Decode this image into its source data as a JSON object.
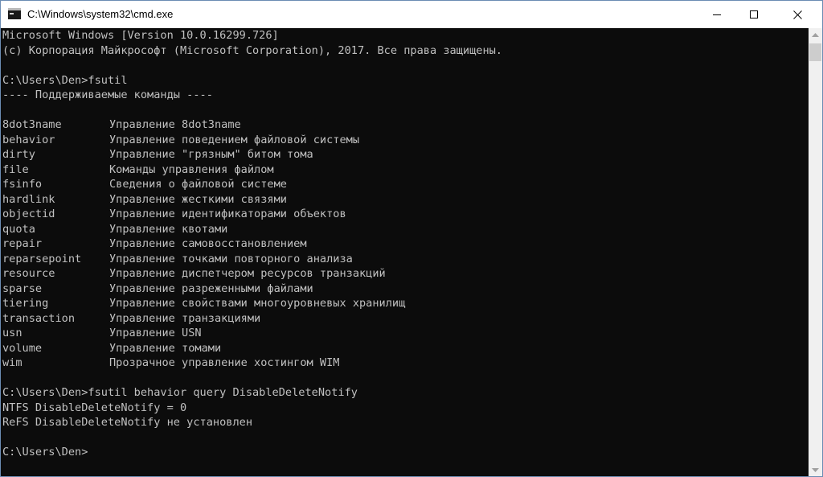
{
  "window": {
    "title": "C:\\Windows\\system32\\cmd.exe"
  },
  "console": {
    "header": [
      "Microsoft Windows [Version 10.0.16299.726]",
      "(c) Корпорация Майкрософт (Microsoft Corporation), 2017. Все права защищены."
    ],
    "prompt1": "C:\\Users\\Den>fsutil",
    "supported_header": "---- Поддерживаемые команды ----",
    "commands": [
      {
        "name": "8dot3name",
        "description": "Управление 8dot3name"
      },
      {
        "name": "behavior",
        "description": "Управление поведением файловой системы"
      },
      {
        "name": "dirty",
        "description": "Управление \"грязным\" битом тома"
      },
      {
        "name": "file",
        "description": "Команды управления файлом"
      },
      {
        "name": "fsinfo",
        "description": "Сведения о файловой системе"
      },
      {
        "name": "hardlink",
        "description": "Управление жесткими связями"
      },
      {
        "name": "objectid",
        "description": "Управление идентификаторами объектов"
      },
      {
        "name": "quota",
        "description": "Управление квотами"
      },
      {
        "name": "repair",
        "description": "Управление самовосстановлением"
      },
      {
        "name": "reparsepoint",
        "description": "Управление точками повторного анализа"
      },
      {
        "name": "resource",
        "description": "Управление диспетчером ресурсов транзакций"
      },
      {
        "name": "sparse",
        "description": "Управление разреженными файлами"
      },
      {
        "name": "tiering",
        "description": "Управление свойствами многоуровневых хранилищ"
      },
      {
        "name": "transaction",
        "description": "Управление транзакциями"
      },
      {
        "name": "usn",
        "description": "Управление USN"
      },
      {
        "name": "volume",
        "description": "Управление томами"
      },
      {
        "name": "wim",
        "description": "Прозрачное управление хостингом WIM"
      }
    ],
    "prompt2": "C:\\Users\\Den>fsutil behavior query DisableDeleteNotify",
    "output2": [
      "NTFS DisableDeleteNotify = 0",
      "ReFS DisableDeleteNotify не установлен"
    ],
    "prompt3": "C:\\Users\\Den>"
  },
  "colors": {
    "console_bg": "#0c0c0c",
    "console_text": "#c0c0c0",
    "titlebar_bg": "#ffffff",
    "border": "#6b8cb3"
  },
  "icons": {
    "app": "cmd-app-icon",
    "minimize": "minimize-icon",
    "maximize": "maximize-icon",
    "close": "close-icon"
  }
}
